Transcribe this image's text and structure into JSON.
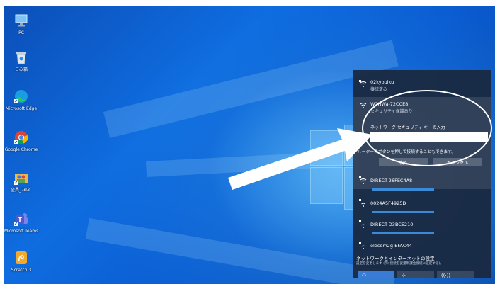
{
  "desktop": {
    "icons": [
      {
        "label": "PC",
        "icon": "computer-icon"
      },
      {
        "label": "ごみ箱",
        "icon": "recycle-bin-icon"
      },
      {
        "label": "Microsoft Edge",
        "icon": "edge-icon"
      },
      {
        "label": "Google Chrome",
        "icon": "chrome-icon"
      },
      {
        "label": "全員_ﾌｫﾙﾀﾞ",
        "icon": "people-folder-icon"
      },
      {
        "label": "Microsoft Teams",
        "icon": "teams-icon"
      },
      {
        "label": "Scratch 3",
        "icon": "scratch-icon"
      }
    ]
  },
  "wifi_panel": {
    "networks": [
      {
        "name": "02kyouiku",
        "status": "接続済み"
      },
      {
        "name": "W2HWa-72CCE8",
        "status": "セキュリティ保護あり"
      },
      {
        "name": "DIRECT-26FEC4A8"
      },
      {
        "name": "0024A5F4925D"
      },
      {
        "name": "DIRECT-D3BCE210"
      },
      {
        "name": "elecom2g-EFAC44"
      }
    ],
    "security_key_label": "ネットワーク セキュリティ キーの入力",
    "security_key_value": "",
    "router_hint": "ルーターのボタンを押して接続することもできます。",
    "next_label": "次へ",
    "cancel_label": "キャンセル",
    "settings_title": "ネットワークとインターネットの設定",
    "settings_desc": "設定を変更します (例: 接続を従量制課金接続に設定する)。",
    "quick_actions": [
      {
        "label": "",
        "icon": "wifi-icon"
      },
      {
        "label": "",
        "icon": "network-icon"
      },
      {
        "label": "",
        "icon": "mobile-hotspot-icon"
      }
    ]
  },
  "colors": {
    "panel_bg": "#1a2a42",
    "accent": "#3a8ad8",
    "annotation": "#ffffff"
  }
}
